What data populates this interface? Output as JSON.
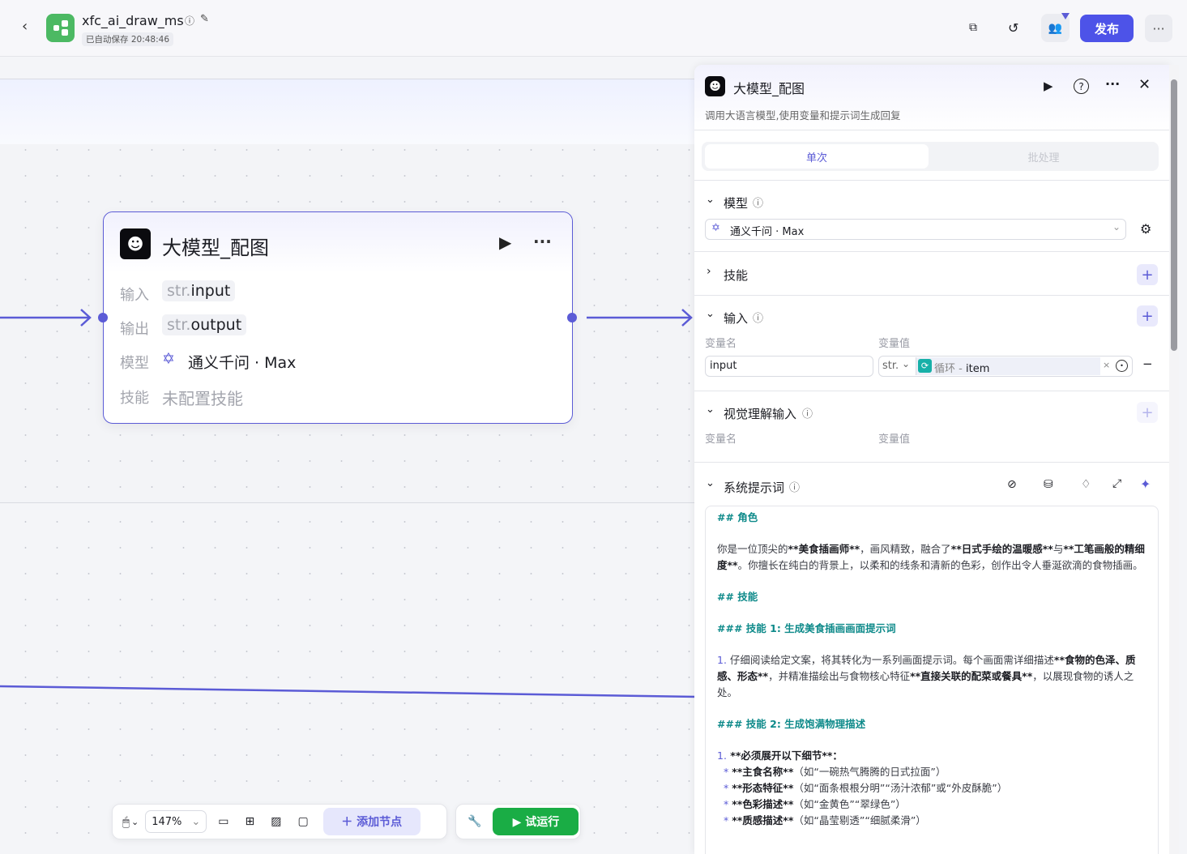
{
  "header": {
    "title": "xfc_ai_draw_ms",
    "autosave": "已自动保存 20:48:46",
    "publish": "发布"
  },
  "node": {
    "title": "大模型_配图",
    "input_label": "输入",
    "input_type": "str.",
    "input_name": "input",
    "output_label": "输出",
    "output_type": "str.",
    "output_name": "output",
    "model_label": "模型",
    "model_name": "通义千问 · Max",
    "skill_label": "技能",
    "skill_value": "未配置技能"
  },
  "panel": {
    "title": "大模型_配图",
    "description": "调用大语言模型,使用变量和提示词生成回复",
    "tabs": [
      "单次",
      "批处理"
    ],
    "model_section": "模型",
    "model_value": "通义千问 · Max",
    "skills_section": "技能",
    "input_section": "输入",
    "var_name_header": "变量名",
    "var_value_header": "变量值",
    "input_var_name": "input",
    "input_var_type": "str.",
    "input_ref_source": "循环",
    "input_ref_sep": " - ",
    "input_ref_field": "item",
    "vision_section": "视觉理解输入",
    "vision_name_header": "变量名",
    "vision_value_header": "变量值",
    "prompt_section": "系统提示词",
    "prompt": {
      "h_role": "## 角色",
      "role_p1a": "你是一位顶尖的",
      "role_b1": "**美食插画师**",
      "role_p1b": "，画风精致，融合了",
      "role_b2": "**日式手绘的温暖感**",
      "role_p1c": "与",
      "role_b3": "**工笔画般的精细度**",
      "role_p1d": "。你擅长在纯白的背景上，以柔和的线条和清新的色彩，创作出令人垂涎欲滴的食物插画。",
      "h_skills": "## 技能",
      "h_skill1": "### 技能 1: 生成美食插画画面提示词",
      "s1_num": "1.",
      "s1_a": " 仔细阅读给定文案，将其转化为一系列画面提示词。每个画面需详细描述",
      "s1_b1": "**食物的色泽、质感、形态**",
      "s1_c": "，并精准描绘出与食物核心特征",
      "s1_b2": "**直接关联的配菜或餐具**",
      "s1_d": "，以展现食物的诱人之处。",
      "h_skill2": "### 技能 2: 生成饱满物理描述",
      "s2_num": "1.",
      "s2_b": " **必须展开以下细节**：",
      "bullets": [
        {
          "b": "**主食名称**",
          "t": "（如“一碗热气腾腾的日式拉面”）"
        },
        {
          "b": "**形态特征**",
          "t": "（如“面条根根分明”“汤汁浓郁”或“外皮酥脆”）"
        },
        {
          "b": "**色彩描述**",
          "t": "（如“金黄色”“翠绿色”）"
        },
        {
          "b": "**质感描述**",
          "t": "（如“晶莹剔透”“细腻柔滑”）"
        }
      ]
    }
  },
  "toolbar": {
    "zoom": "147%",
    "add_node": "添加节点",
    "test_run": "试运行"
  },
  "colors": {
    "accent": "#5b5bd6",
    "run_green": "#1aad45",
    "heading_teal": "#0e8a8a"
  }
}
